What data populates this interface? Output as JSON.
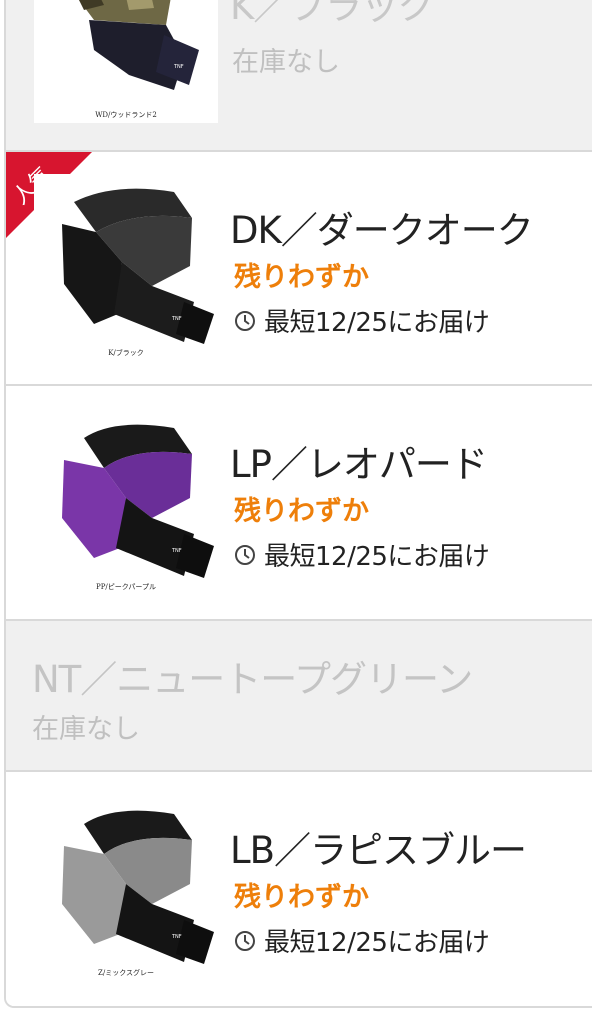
{
  "rows": [
    {
      "thumb_caption": "WD/ウッドランド2",
      "name": "K／ブラック",
      "stock": "在庫なし",
      "out_of_stock": true
    },
    {
      "badge": "人気",
      "thumb_caption": "K/ブラック",
      "name": "DK／ダークオーク",
      "stock": "残りわずか",
      "delivery": "最短12/25にお届け"
    },
    {
      "thumb_caption": "PP/ピークパープル",
      "name": "LP／レオパード",
      "stock": "残りわずか",
      "delivery": "最短12/25にお届け"
    },
    {
      "name": "NT／ニュートープグリーン",
      "stock": "在庫なし",
      "out_of_stock": true
    },
    {
      "thumb_caption": "Z/ミックスグレー",
      "name": "LB／ラピスブルー",
      "stock": "残りわずか",
      "delivery": "最短12/25にお届け"
    }
  ],
  "icons": {
    "delivery": "clock-icon"
  },
  "colors": {
    "low_stock": "#ee7f0a",
    "badge": "#d7152f",
    "out_of_stock_text": "#c4c4c4",
    "disabled_bg": "#f0f0f0",
    "border": "#d9d9d9"
  }
}
